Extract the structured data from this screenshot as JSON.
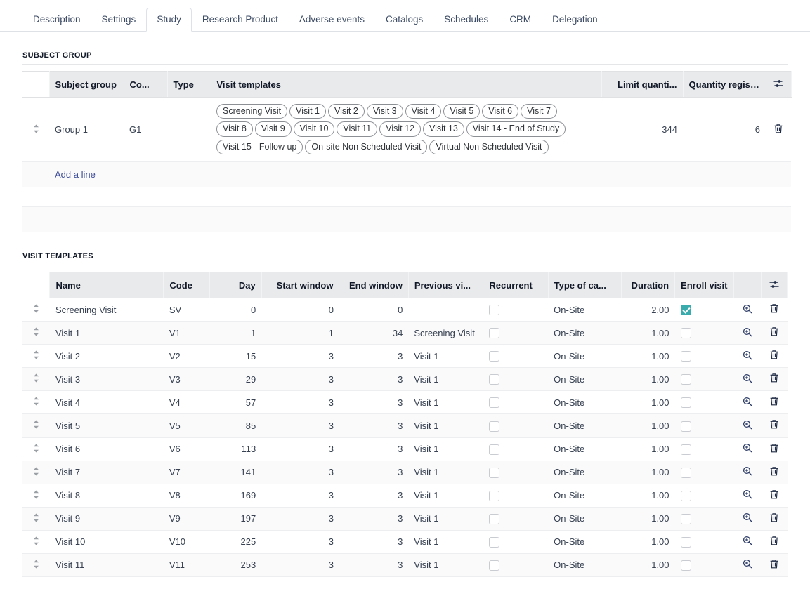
{
  "tabs": [
    {
      "label": "Description",
      "active": false
    },
    {
      "label": "Settings",
      "active": false
    },
    {
      "label": "Study",
      "active": true
    },
    {
      "label": "Research Product",
      "active": false
    },
    {
      "label": "Adverse events",
      "active": false
    },
    {
      "label": "Catalogs",
      "active": false
    },
    {
      "label": "Schedules",
      "active": false
    },
    {
      "label": "CRM",
      "active": false
    },
    {
      "label": "Delegation",
      "active": false
    }
  ],
  "subject_group": {
    "title": "SUBJECT GROUP",
    "columns": [
      "Subject group",
      "Co...",
      "Type",
      "Visit templates",
      "Limit quanti...",
      "Quantity register..."
    ],
    "rows": [
      {
        "subject_group": "Group 1",
        "code": "G1",
        "type": "",
        "visit_templates": [
          "Screening Visit",
          "Visit 1",
          "Visit 2",
          "Visit 3",
          "Visit 4",
          "Visit 5",
          "Visit 6",
          "Visit 7",
          "Visit 8",
          "Visit 9",
          "Visit 10",
          "Visit 11",
          "Visit 12",
          "Visit 13",
          "Visit 14 - End of Study",
          "Visit 15 - Follow up",
          "On-site Non Scheduled Visit",
          "Virtual Non Scheduled Visit"
        ],
        "limit_quantity": "344",
        "quantity_registered": "6"
      }
    ],
    "add_line_label": "Add a line"
  },
  "visit_templates": {
    "title": "VISIT TEMPLATES",
    "columns": [
      "Name",
      "Code",
      "Day",
      "Start window",
      "End window",
      "Previous vi...",
      "Recurrent",
      "Type of ca...",
      "Duration",
      "Enroll visit"
    ],
    "rows": [
      {
        "name": "Screening Visit",
        "code": "SV",
        "day": "0",
        "start_window": "0",
        "end_window": "0",
        "previous_visit": "",
        "recurrent": false,
        "type_of_care": "On-Site",
        "duration": "2.00",
        "enroll_visit": true
      },
      {
        "name": "Visit 1",
        "code": "V1",
        "day": "1",
        "start_window": "1",
        "end_window": "34",
        "previous_visit": "Screening Visit",
        "recurrent": false,
        "type_of_care": "On-Site",
        "duration": "1.00",
        "enroll_visit": false
      },
      {
        "name": "Visit 2",
        "code": "V2",
        "day": "15",
        "start_window": "3",
        "end_window": "3",
        "previous_visit": "Visit 1",
        "recurrent": false,
        "type_of_care": "On-Site",
        "duration": "1.00",
        "enroll_visit": false
      },
      {
        "name": "Visit 3",
        "code": "V3",
        "day": "29",
        "start_window": "3",
        "end_window": "3",
        "previous_visit": "Visit 1",
        "recurrent": false,
        "type_of_care": "On-Site",
        "duration": "1.00",
        "enroll_visit": false
      },
      {
        "name": "Visit 4",
        "code": "V4",
        "day": "57",
        "start_window": "3",
        "end_window": "3",
        "previous_visit": "Visit 1",
        "recurrent": false,
        "type_of_care": "On-Site",
        "duration": "1.00",
        "enroll_visit": false
      },
      {
        "name": "Visit 5",
        "code": "V5",
        "day": "85",
        "start_window": "3",
        "end_window": "3",
        "previous_visit": "Visit 1",
        "recurrent": false,
        "type_of_care": "On-Site",
        "duration": "1.00",
        "enroll_visit": false
      },
      {
        "name": "Visit 6",
        "code": "V6",
        "day": "113",
        "start_window": "3",
        "end_window": "3",
        "previous_visit": "Visit 1",
        "recurrent": false,
        "type_of_care": "On-Site",
        "duration": "1.00",
        "enroll_visit": false
      },
      {
        "name": "Visit 7",
        "code": "V7",
        "day": "141",
        "start_window": "3",
        "end_window": "3",
        "previous_visit": "Visit 1",
        "recurrent": false,
        "type_of_care": "On-Site",
        "duration": "1.00",
        "enroll_visit": false
      },
      {
        "name": "Visit 8",
        "code": "V8",
        "day": "169",
        "start_window": "3",
        "end_window": "3",
        "previous_visit": "Visit 1",
        "recurrent": false,
        "type_of_care": "On-Site",
        "duration": "1.00",
        "enroll_visit": false
      },
      {
        "name": "Visit 9",
        "code": "V9",
        "day": "197",
        "start_window": "3",
        "end_window": "3",
        "previous_visit": "Visit 1",
        "recurrent": false,
        "type_of_care": "On-Site",
        "duration": "1.00",
        "enroll_visit": false
      },
      {
        "name": "Visit 10",
        "code": "V10",
        "day": "225",
        "start_window": "3",
        "end_window": "3",
        "previous_visit": "Visit 1",
        "recurrent": false,
        "type_of_care": "On-Site",
        "duration": "1.00",
        "enroll_visit": false
      },
      {
        "name": "Visit 11",
        "code": "V11",
        "day": "253",
        "start_window": "3",
        "end_window": "3",
        "previous_visit": "Visit 1",
        "recurrent": false,
        "type_of_care": "On-Site",
        "duration": "1.00",
        "enroll_visit": false
      }
    ]
  },
  "icons": {
    "drag_handle": "drag-handle-icon",
    "column_settings": "sliders-icon",
    "delete": "trash-icon",
    "zoom": "magnify-plus-icon"
  },
  "colors": {
    "accent_teal": "#3aabad",
    "header_bg": "#e9eaec",
    "link": "#3c4b9a",
    "text": "#374151"
  }
}
